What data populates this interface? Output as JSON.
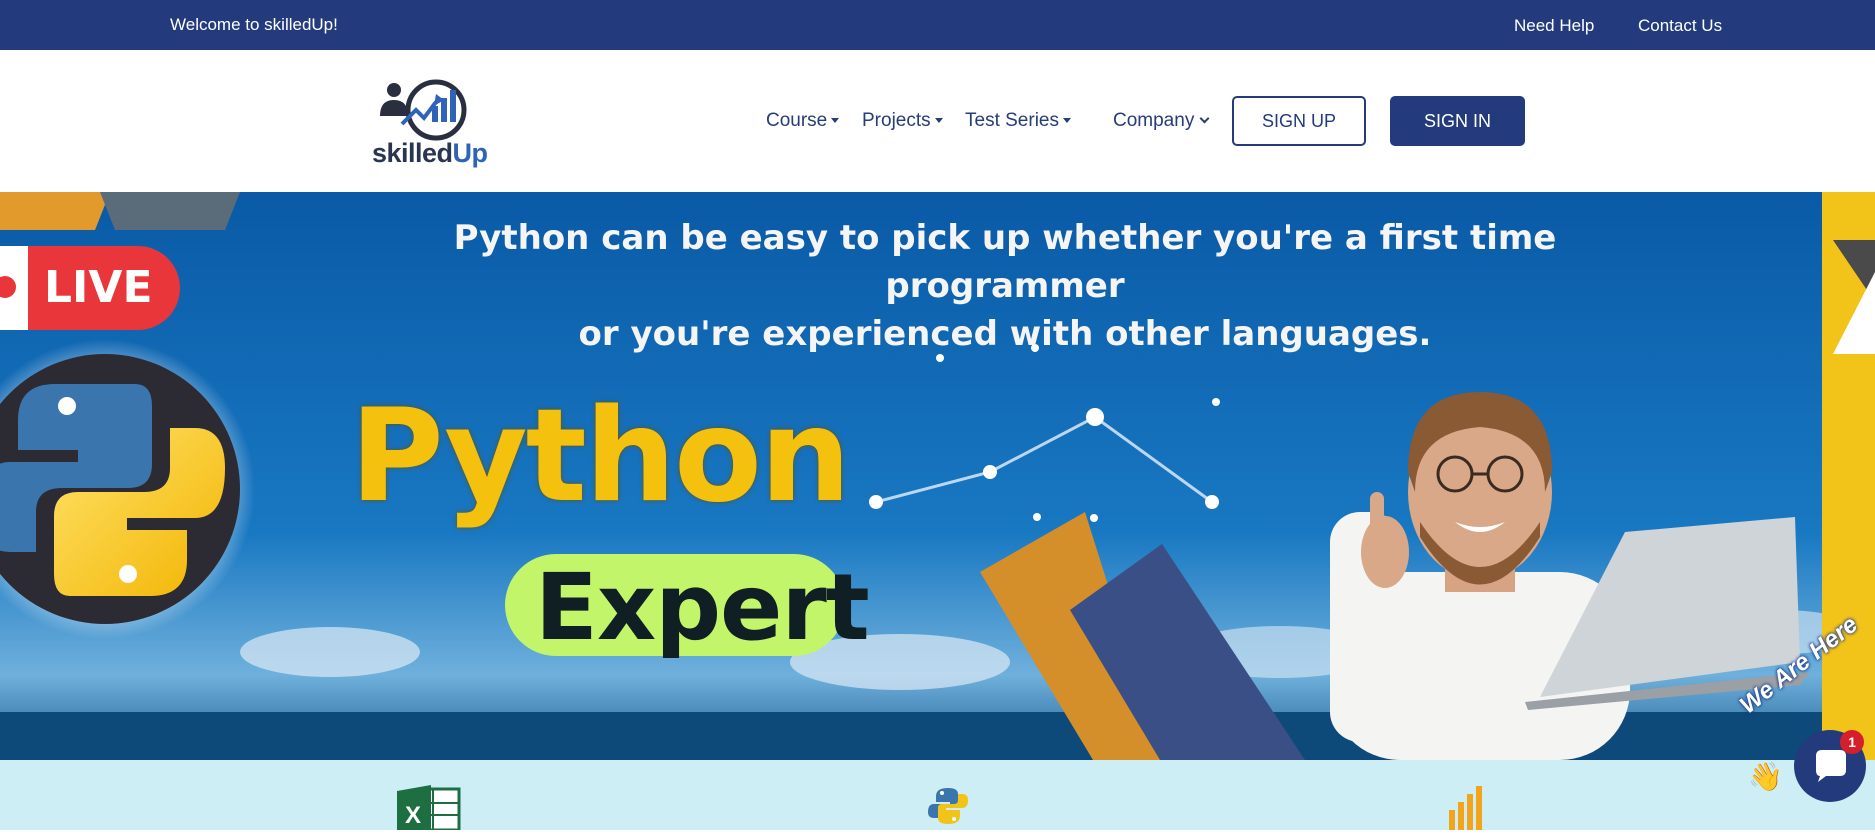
{
  "topbar": {
    "welcome": "Welcome to skilledUp!",
    "need_help": "Need Help",
    "contact_us": "Contact Us"
  },
  "brand": {
    "logo_text_main": "skilled",
    "logo_text_accent": "Up"
  },
  "nav": {
    "course": "Course",
    "projects": "Projects",
    "test_series": "Test Series",
    "company": "Company",
    "sign_up": "SIGN UP",
    "sign_in": "SIGN IN"
  },
  "hero": {
    "headline_line1": "Python can be easy to pick up whether you're a first time programmer",
    "headline_line2": "or you're experienced with other languages.",
    "live": "LIVE",
    "title": "Python",
    "subtitle": "Expert"
  },
  "chat": {
    "tagline": "We Are Here",
    "badge_count": "1"
  },
  "colors": {
    "brand_navy": "#233b7c",
    "hero_blue": "#0f68b0",
    "python_yellow": "#f5c10f",
    "expert_green": "#c3f56a",
    "live_red": "#e8363a",
    "strip_bg": "#cdeef5"
  },
  "icons": {
    "course_strip": [
      "excel-icon",
      "python-icon",
      "power-bi-icon"
    ]
  }
}
